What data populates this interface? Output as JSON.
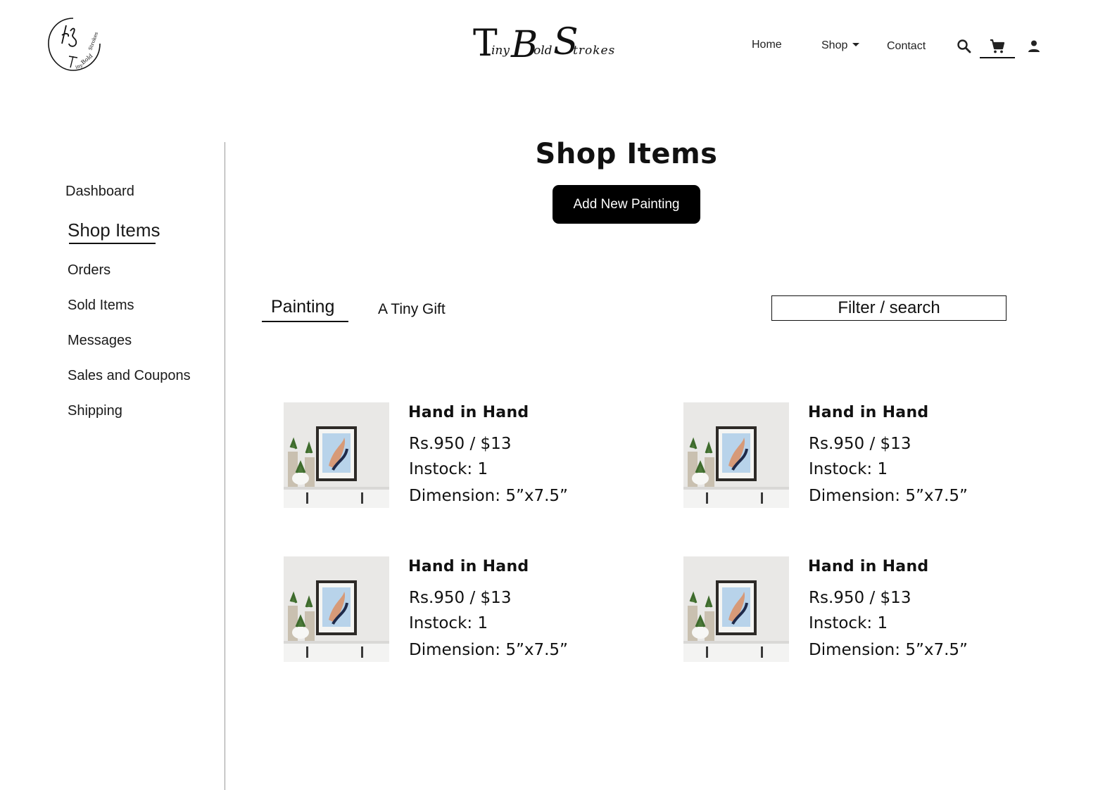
{
  "header": {
    "logo_mark_text": "TBS Tiny Bold Strokes",
    "brand": {
      "t1": "T",
      "t2": "iny",
      "b1": "B",
      "b2": "old",
      "s1": "S",
      "s2": "trokes"
    },
    "nav": {
      "home": "Home",
      "shop": "Shop",
      "contact": "Contact"
    },
    "icons": [
      "search-icon",
      "cart-icon",
      "user-icon"
    ]
  },
  "sidebar": {
    "items": [
      {
        "label": "Dashboard"
      },
      {
        "label": "Shop Items",
        "active": true
      },
      {
        "label": "Orders"
      },
      {
        "label": "Sold Items"
      },
      {
        "label": "Messages"
      },
      {
        "label": "Sales and Coupons"
      },
      {
        "label": "Shipping"
      }
    ]
  },
  "main": {
    "title": "Shop Items",
    "add_button": "Add New Painting",
    "tabs": [
      {
        "label": "Painting",
        "active": true
      },
      {
        "label": "A Tiny Gift"
      }
    ],
    "filter_placeholder": "Filter / search",
    "products": [
      {
        "name": "Hand in Hand",
        "price": "Rs.950 / $13",
        "stock": "Instock: 1",
        "dimension": "Dimension: 5”x7.5”"
      },
      {
        "name": "Hand in Hand",
        "price": "Rs.950 / $13",
        "stock": "Instock: 1",
        "dimension": "Dimension: 5”x7.5”"
      },
      {
        "name": "Hand in Hand",
        "price": "Rs.950 / $13",
        "stock": "Instock: 1",
        "dimension": "Dimension: 5”x7.5”"
      },
      {
        "name": "Hand in Hand",
        "price": "Rs.950 / $13",
        "stock": "Instock: 1",
        "dimension": "Dimension: 5”x7.5”"
      }
    ]
  },
  "colors": {
    "accent": "#000000",
    "text": "#111111",
    "divider": "#9a9a9a",
    "background": "#ffffff"
  }
}
